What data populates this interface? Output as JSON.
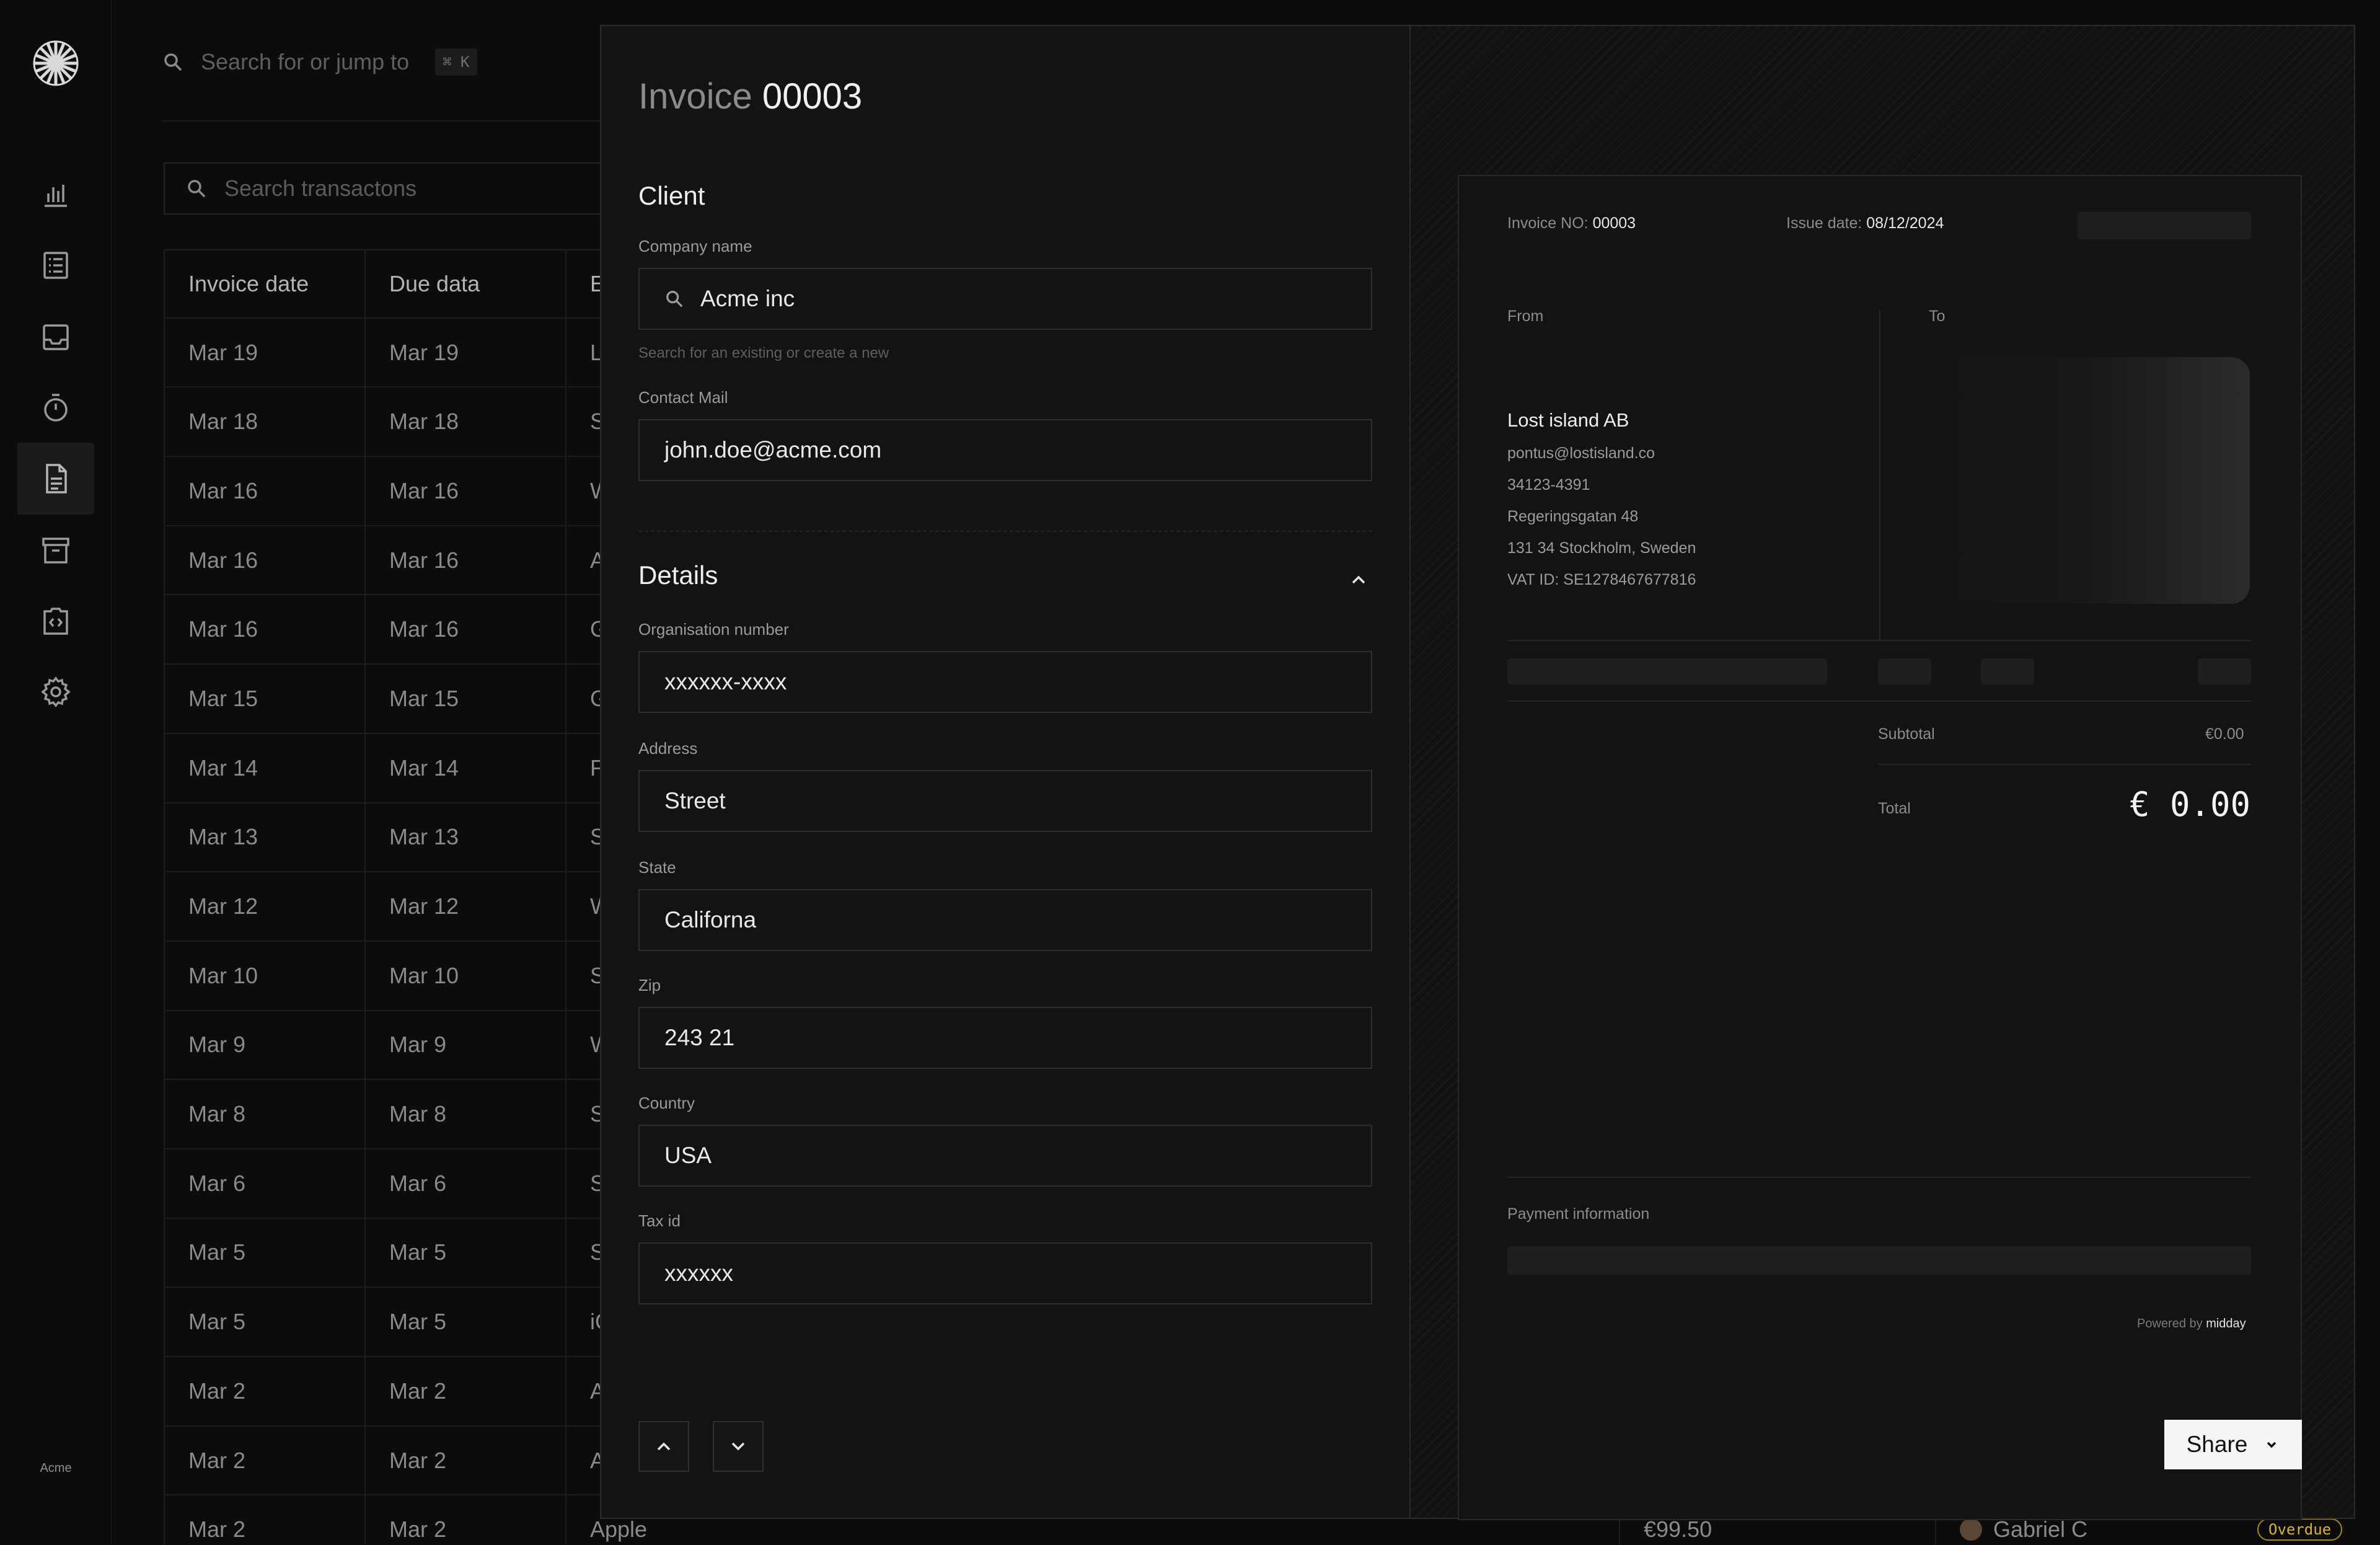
{
  "sidebar": {
    "logo": "midday-logo",
    "items": [
      {
        "icon": "chart-icon",
        "active": false
      },
      {
        "icon": "transactions-list-icon",
        "active": false
      },
      {
        "icon": "inbox-icon",
        "active": false
      },
      {
        "icon": "timer-icon",
        "active": false
      },
      {
        "icon": "invoice-icon",
        "active": true
      },
      {
        "icon": "vault-archive-icon",
        "active": false
      },
      {
        "icon": "apps-icon",
        "active": false
      },
      {
        "icon": "settings-icon",
        "active": false
      }
    ],
    "workspace_label": "Acme"
  },
  "header": {
    "search_placeholder": "Search for or jump to",
    "shortcut": "⌘ K"
  },
  "transactions": {
    "search_placeholder": "Search transactons",
    "columns": [
      "Invoice date",
      "Due data",
      "E"
    ],
    "rows": [
      {
        "invoice_date": "Mar 19",
        "due_date": "Mar 19",
        "name": "L"
      },
      {
        "invoice_date": "Mar 18",
        "due_date": "Mar 18",
        "name": "S"
      },
      {
        "invoice_date": "Mar 16",
        "due_date": "Mar 16",
        "name": "W"
      },
      {
        "invoice_date": "Mar 16",
        "due_date": "Mar 16",
        "name": "A"
      },
      {
        "invoice_date": "Mar 16",
        "due_date": "Mar 16",
        "name": "G"
      },
      {
        "invoice_date": "Mar 15",
        "due_date": "Mar 15",
        "name": "G"
      },
      {
        "invoice_date": "Mar 14",
        "due_date": "Mar 14",
        "name": "F"
      },
      {
        "invoice_date": "Mar 13",
        "due_date": "Mar 13",
        "name": "S"
      },
      {
        "invoice_date": "Mar 12",
        "due_date": "Mar 12",
        "name": "W"
      },
      {
        "invoice_date": "Mar 10",
        "due_date": "Mar 10",
        "name": "S"
      },
      {
        "invoice_date": "Mar 9",
        "due_date": "Mar 9",
        "name": "W"
      },
      {
        "invoice_date": "Mar 8",
        "due_date": "Mar 8",
        "name": "S"
      },
      {
        "invoice_date": "Mar 6",
        "due_date": "Mar 6",
        "name": "S"
      },
      {
        "invoice_date": "Mar 5",
        "due_date": "Mar 5",
        "name": "S"
      },
      {
        "invoice_date": "Mar 5",
        "due_date": "Mar 5",
        "name": "iC"
      },
      {
        "invoice_date": "Mar 2",
        "due_date": "Mar 2",
        "name": "A"
      },
      {
        "invoice_date": "Mar 2",
        "due_date": "Mar 2",
        "name": "A"
      }
    ],
    "last_row": {
      "invoice_date": "Mar 2",
      "due_date": "Mar 2",
      "name": "Apple",
      "amount": "€99.50",
      "assigned": "Gabriel C",
      "status": "Overdue"
    }
  },
  "invoice_form": {
    "title_prefix": "Invoice",
    "title_number": "00003",
    "client_section": "Client",
    "company_label": "Company name",
    "company_value": "Acme inc",
    "company_hint": "Search for an existing or create a new",
    "contact_label": "Contact Mail",
    "contact_value": "john.doe@acme.com",
    "details_section": "Details",
    "org_label": "Organisation number",
    "org_value": "xxxxxx-xxxx",
    "address_label": "Address",
    "address_value": "Street",
    "state_label": "State",
    "state_value": "Californa",
    "zip_label": "Zip",
    "zip_value": "243 21",
    "country_label": "Country",
    "country_value": "USA",
    "taxid_label": "Tax id",
    "taxid_value": "xxxxxx"
  },
  "invoice_preview": {
    "invoice_no_label": "Invoice NO:",
    "invoice_no": "00003",
    "issue_date_label": "Issue date:",
    "issue_date": "08/12/2024",
    "from_label": "From",
    "to_label": "To",
    "from_name": "Lost island AB",
    "from_email": "pontus@lostisland.co",
    "from_phone": "34123-4391",
    "from_street": "Regeringsgatan 48",
    "from_city": "131 34 Stockholm, Sweden",
    "from_vat": "VAT ID: SE1278467677816",
    "subtotal_label": "Subtotal",
    "subtotal_value": "€0.00",
    "total_label": "Total",
    "total_value": "€ 0.00",
    "payment_label": "Payment information",
    "powered_by": "Powered by",
    "powered_brand": "midday"
  },
  "actions": {
    "share_label": "Share"
  }
}
